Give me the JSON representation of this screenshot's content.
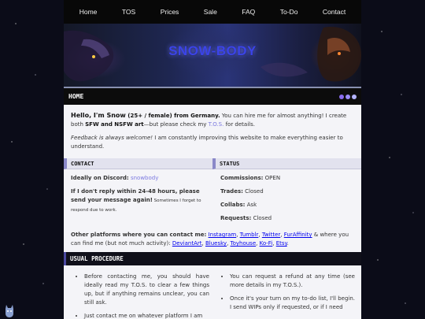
{
  "nav": {
    "items": [
      "Home",
      "TOS",
      "Prices",
      "Sale",
      "FAQ",
      "To-Do",
      "Contact"
    ]
  },
  "banner": {
    "logo_text": "SNOW-BODY"
  },
  "home": {
    "title": "HOME",
    "dot_colors": [
      "#8a6cf0",
      "#9a8cf8",
      "#b4b4ff"
    ],
    "intro": {
      "greeting": "Hello, I'm Snow",
      "age": " (25+ / female) from Germany.",
      "t1": " You can hire me for almost anything! I create both ",
      "sfw": "SFW and NSFW art",
      "t2": "—but please check my ",
      "tos_link": "T.O.S.",
      "t3": " for details."
    },
    "feedback": {
      "italic": "Feedback is always welcome!",
      "rest": " I am constantly improving this website to make everything easier to understand."
    }
  },
  "contact": {
    "title": "CONTACT",
    "discord_label": "Ideally on Discord:",
    "discord_value": "snowbody",
    "reply_bold": "If I don't reply within 24-48 hours, please send your message again!",
    "reply_small": " Sometimes I forget to respond due to work."
  },
  "status": {
    "title": "STATUS",
    "items": [
      {
        "label": "Commissions:",
        "value": "OPEN"
      },
      {
        "label": "Trades:",
        "value": "Closed"
      },
      {
        "label": "Collabs:",
        "value": "Ask"
      },
      {
        "label": "Requests:",
        "value": "Closed"
      }
    ]
  },
  "platforms": {
    "bold1": "Other platforms where you can ",
    "contact_word": "contact",
    "bold2": " me:",
    "links_a": [
      "Instagram",
      "Tumblr",
      "Twitter",
      "FurAffinity"
    ],
    "mid1": " & where you can ",
    "find_word": "find",
    "mid2": " me (but not much activity): ",
    "links_b": [
      "DeviantArt",
      "Bluesky",
      "Toyhouse",
      "Ko-Fi",
      "Etsy"
    ]
  },
  "procedure": {
    "title": "USUAL PROCEDURE",
    "left_items": [
      "Before contacting me, you should have ideally read my T.O.S. to clear a few things up, but if anything remains unclear, you can still ask.",
      "Just contact me on whatever platform I am"
    ],
    "right_items": [
      "You can request a refund at any time (see more details in my T.O.S.).",
      "Once it's your turn on my to-do list, I'll begin. I send WIPs only if requested, or if I need"
    ]
  }
}
